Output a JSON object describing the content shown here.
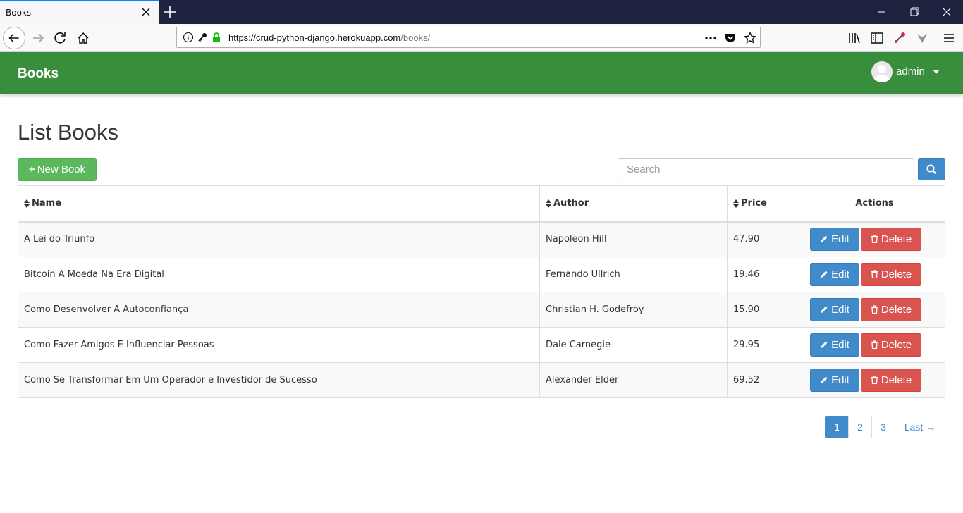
{
  "browser": {
    "tab_title": "Books",
    "url_main": "https://crud-python-django.herokuapp.com",
    "url_path": "/books/"
  },
  "app": {
    "brand": "Books",
    "user_name": "admin"
  },
  "page": {
    "title": "List Books",
    "new_button_label": "New Book",
    "search_placeholder": "Search"
  },
  "table": {
    "headers": {
      "name": "Name",
      "author": "Author",
      "price": "Price",
      "actions": "Actions"
    },
    "edit_label": "Edit",
    "delete_label": "Delete",
    "rows": [
      {
        "name": "A Lei do Triunfo",
        "author": "Napoleon Hill",
        "price": "47.90"
      },
      {
        "name": "Bitcoin A Moeda Na Era Digital",
        "author": "Fernando Ullrich",
        "price": "19.46"
      },
      {
        "name": "Como Desenvolver A Autoconfiança",
        "author": "Christian H. Godefroy",
        "price": "15.90"
      },
      {
        "name": "Como Fazer Amigos E Influenciar Pessoas",
        "author": "Dale Carnegie",
        "price": "29.95"
      },
      {
        "name": "Como Se Transformar Em Um Operador e Investidor de Sucesso",
        "author": "Alexander Elder",
        "price": "69.52"
      }
    ]
  },
  "pagination": {
    "pages": [
      "1",
      "2",
      "3"
    ],
    "active": "1",
    "last_label": "Last →"
  },
  "colors": {
    "navbar": "#388e3c",
    "primary": "#428bca",
    "success": "#5cb85c",
    "danger": "#d9534f"
  }
}
